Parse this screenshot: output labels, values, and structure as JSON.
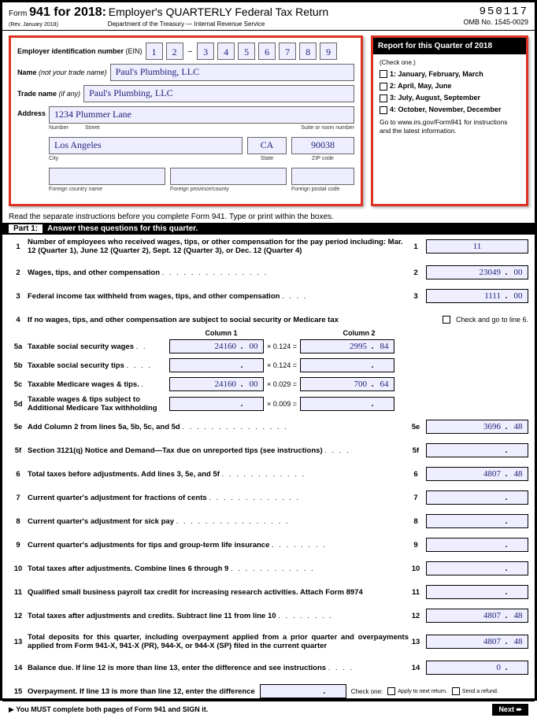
{
  "header": {
    "form_label": "Form",
    "rev": "(Rev. January 2018)",
    "form_num": "941 for 2018:",
    "title": "Employer's QUARTERLY Federal Tax Return",
    "dept": "Department of the Treasury — Internal Revenue Service",
    "code": "950117",
    "omb": "OMB No. 1545-0029"
  },
  "employer": {
    "ein_label": "Employer identification number",
    "ein_abbr": "(EIN)",
    "ein": [
      "1",
      "2",
      "3",
      "4",
      "5",
      "6",
      "7",
      "8",
      "9"
    ],
    "name_label": "Name",
    "name_note": "(not your trade name)",
    "name": "Paul's Plumbing, LLC",
    "trade_label": "Trade name",
    "trade_note": "(if any)",
    "trade": "Paul's Plumbing, LLC",
    "address_label": "Address",
    "street": "1234 Plummer Lane",
    "number_label": "Number",
    "street_label": "Street",
    "suite_label": "Suite or room number",
    "city": "Los Angeles",
    "state": "CA",
    "zip": "90038",
    "city_label": "City",
    "state_label": "State",
    "zip_label": "ZIP code",
    "fcountry_label": "Foreign country name",
    "fprovince_label": "Foreign province/county",
    "fpostal_label": "Foreign postal code"
  },
  "quarter": {
    "title": "Report for this Quarter of 2018",
    "check": "(Check one.)",
    "q1": "1: January, February, March",
    "q2": "2: April, May, June",
    "q3": "3: July, August, September",
    "q4": "4: October, November, December",
    "info": "Go to www.irs.gov/Form941 for instructions and the latest information."
  },
  "instructions": "Read the separate instructions before you complete Form 941. Type or print within the boxes.",
  "part1": {
    "label": "Part 1:",
    "title": "Answer these questions for this quarter."
  },
  "lines": {
    "l1": {
      "text": "Number of employees who received wages, tips, or other compensation for the pay period including: Mar. 12 (Quarter 1), June 12 (Quarter 2), Sept. 12 (Quarter 3), or Dec. 12 (Quarter 4)",
      "num": "1",
      "val": "11"
    },
    "l2": {
      "text": "Wages, tips, and other compensation",
      "num": "2",
      "val": "23049",
      "cents": "00"
    },
    "l3": {
      "text": "Federal income tax withheld from wages, tips, and other compensation",
      "num": "3",
      "val": "1111",
      "cents": "00"
    },
    "l4": {
      "text": "If no wages, tips, and other compensation are subject to social security or Medicare tax",
      "check": "Check and go to line 6."
    },
    "col1": "Column 1",
    "col2": "Column 2",
    "l5a": {
      "text": "Taxable social security wages",
      "c1": "24160",
      "c1c": "00",
      "mult": "× 0.124 =",
      "c2": "2995",
      "c2c": "84"
    },
    "l5b": {
      "text": "Taxable social security tips",
      "mult": "× 0.124 ="
    },
    "l5c": {
      "text": "Taxable Medicare wages & tips.",
      "c1": "24160",
      "c1c": "00",
      "mult": "× 0.029 =",
      "c2": "700",
      "c2c": "64"
    },
    "l5d": {
      "text": "Taxable wages & tips subject to Additional Medicare Tax withholding",
      "mult": "× 0.009 ="
    },
    "l5e": {
      "text": "Add Column 2 from lines 5a, 5b, 5c, and 5d",
      "num": "5e",
      "val": "3696",
      "cents": "48"
    },
    "l5f": {
      "text": "Section 3121(q) Notice and Demand—Tax due on unreported tips (see instructions)",
      "num": "5f"
    },
    "l6": {
      "text": "Total taxes before adjustments. Add lines 3, 5e, and 5f",
      "num": "6",
      "val": "4807",
      "cents": "48"
    },
    "l7": {
      "text": "Current quarter's adjustment for fractions of cents",
      "num": "7"
    },
    "l8": {
      "text": "Current quarter's adjustment for sick pay",
      "num": "8"
    },
    "l9": {
      "text": "Current quarter's adjustments for tips and group-term life insurance",
      "num": "9"
    },
    "l10": {
      "text": "Total taxes after adjustments. Combine lines 6 through 9",
      "num": "10"
    },
    "l11": {
      "text": "Qualified small business payroll tax credit for increasing research activities. Attach Form 8974",
      "num": "11"
    },
    "l12": {
      "text": "Total taxes after adjustments and credits. Subtract line 11 from line 10",
      "num": "12",
      "val": "4807",
      "cents": "48"
    },
    "l13": {
      "text": "Total deposits for this quarter, including overpayment applied from a prior quarter and overpayments applied from Form 941-X, 941-X (PR), 944-X, or 944-X (SP) filed in the current quarter",
      "num": "13",
      "val": "4807",
      "cents": "48"
    },
    "l14": {
      "text": "Balance due. If line 12 is more than line 13, enter the difference and see instructions",
      "num": "14",
      "val": "0"
    },
    "l15": {
      "text": "Overpayment. If line 13 is more than line 12, enter the difference",
      "check_label": "Check one:",
      "opt1": "Apply to next return.",
      "opt2": "Send a refund."
    }
  },
  "footer": {
    "sign": "You MUST complete both pages of Form 941 and SIGN it.",
    "next": "Next ➨"
  }
}
